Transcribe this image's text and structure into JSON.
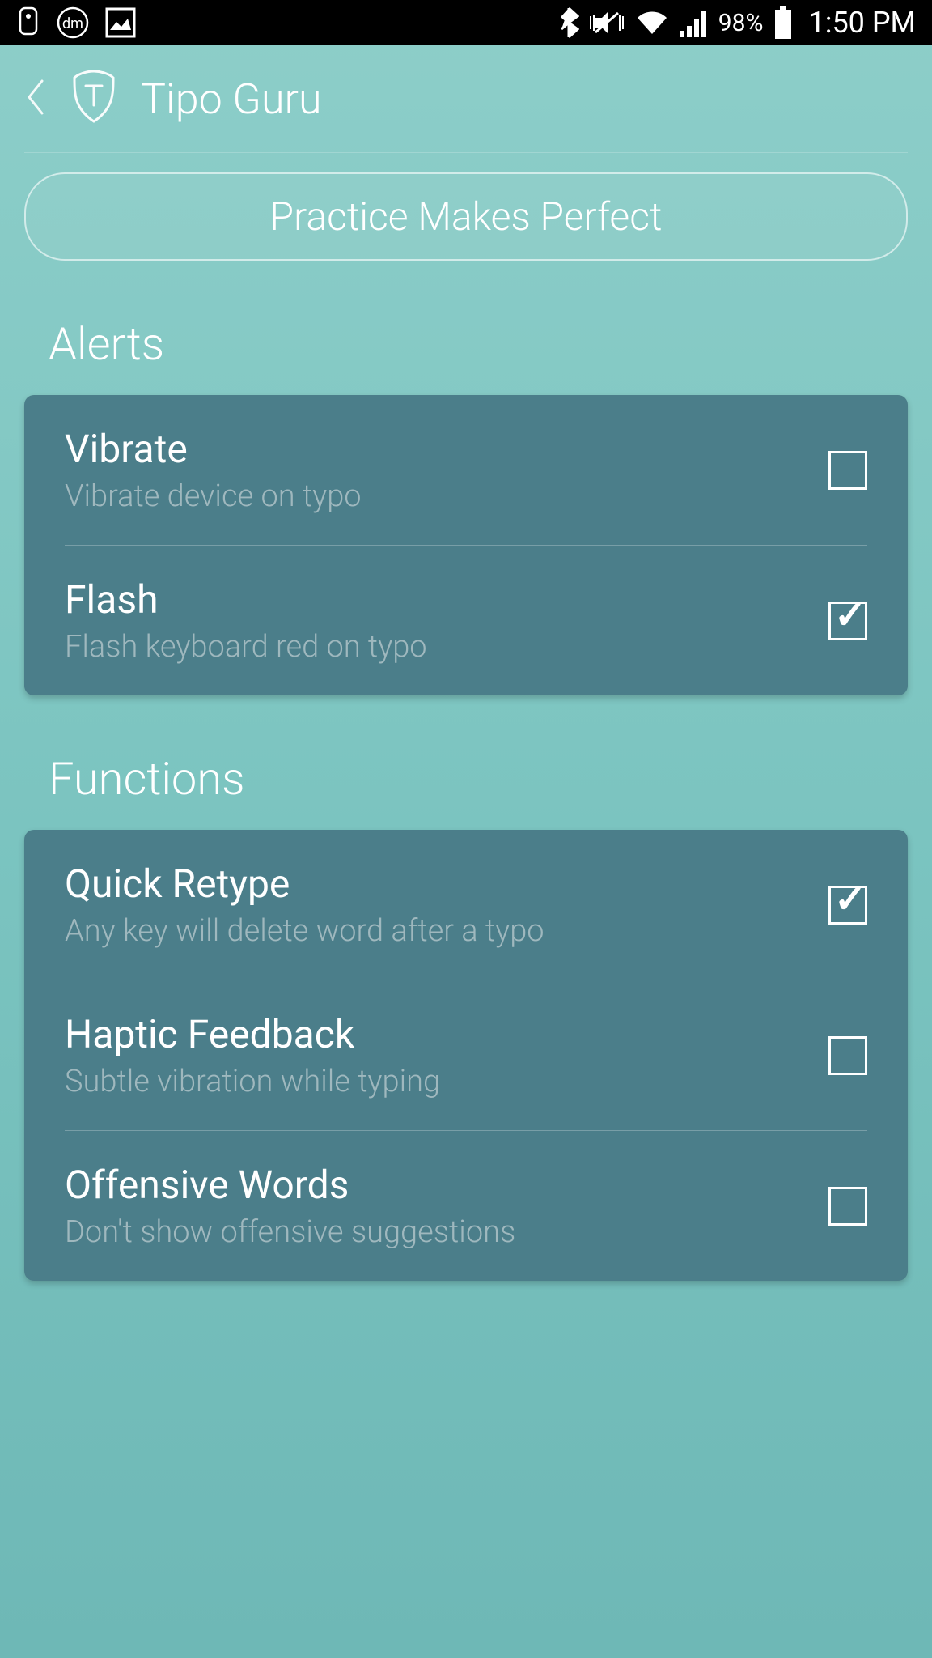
{
  "status_bar": {
    "battery_percent": "98%",
    "time": "1:50 PM"
  },
  "header": {
    "title": "Tipo Guru"
  },
  "practice_button": {
    "label": "Practice Makes Perfect"
  },
  "sections": {
    "alerts": {
      "title": "Alerts",
      "items": [
        {
          "title": "Vibrate",
          "subtitle": "Vibrate device on typo",
          "checked": false
        },
        {
          "title": "Flash",
          "subtitle": "Flash keyboard red on typo",
          "checked": true
        }
      ]
    },
    "functions": {
      "title": "Functions",
      "items": [
        {
          "title": "Quick Retype",
          "subtitle": "Any key will delete word after a typo",
          "checked": true
        },
        {
          "title": "Haptic Feedback",
          "subtitle": "Subtle vibration while typing",
          "checked": false
        },
        {
          "title": "Offensive Words",
          "subtitle": "Don't show offensive suggestions",
          "checked": false
        }
      ]
    }
  }
}
